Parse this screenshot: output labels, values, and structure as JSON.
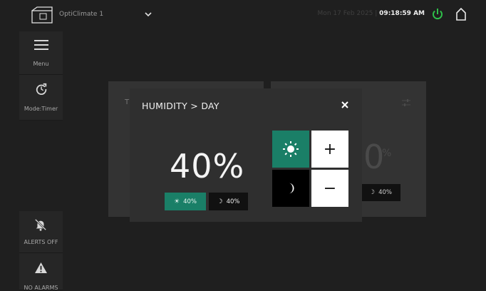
{
  "topbar": {
    "device_name": "OptiClimate 1",
    "date": "Mon 17 Feb 2025 |",
    "time": "09:18:59 AM",
    "power_color": "#2fc04a"
  },
  "sidebar": {
    "menu_label": "Menu",
    "mode_label": "Mode:Timer",
    "alerts_label": "ALERTS OFF",
    "alarms_label": "NO ALARMS"
  },
  "background_card": {
    "left_title_partial": "T",
    "right_value_partial": "0",
    "right_unit": "%",
    "right_night_label": "40%"
  },
  "modal": {
    "title": "HUMIDITY  >  DAY",
    "value": "40%",
    "day_pill": "40%",
    "night_pill": "40%",
    "plus_label": "+",
    "minus_label": "−"
  },
  "colors": {
    "accent": "#1a7f67",
    "background": "#1f1f1f",
    "panel": "#2f2f2f"
  }
}
